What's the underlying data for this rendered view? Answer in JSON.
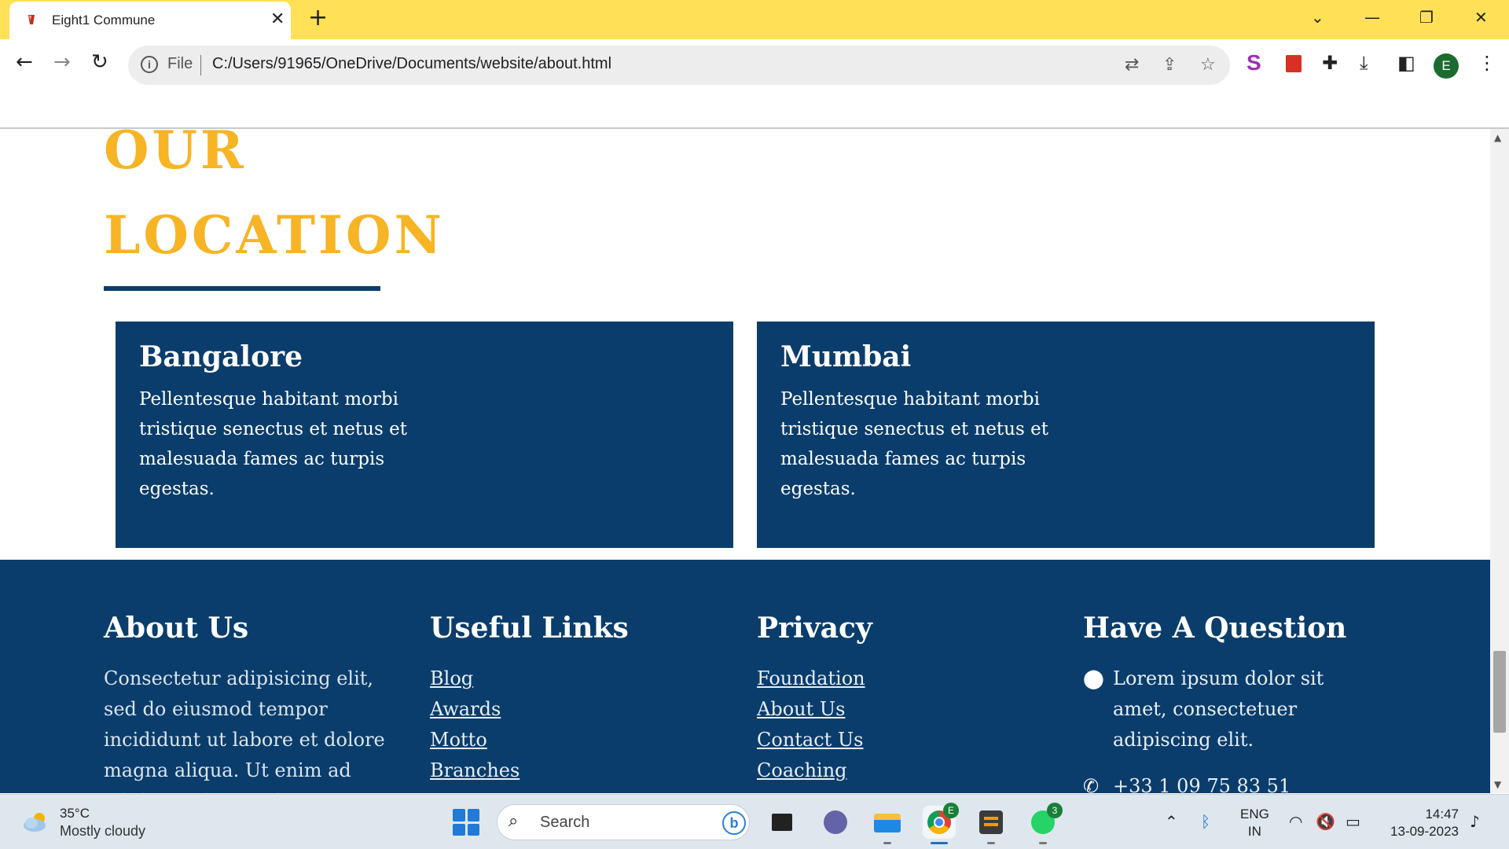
{
  "browser": {
    "tab_title": "Eight1 Commune",
    "close_glyph": "✕",
    "new_tab_glyph": "+",
    "url_scheme_label": "File",
    "url": "C:/Users/91965/OneDrive/Documents/website/about.html",
    "accent_color": "#ffe057",
    "profile_initial": "E"
  },
  "page": {
    "heading_line1": "OUR",
    "heading_line2": "LOCATION",
    "heading_color": "#f7b425",
    "brand_navy": "#0a3d6b",
    "locations": [
      {
        "city": "Bangalore",
        "description": "Pellentesque habitant morbi tristique senectus et netus et malesuada fames ac turpis egestas."
      },
      {
        "city": "Mumbai",
        "description": "Pellentesque habitant morbi tristique senectus et netus et malesuada fames ac turpis egestas."
      }
    ]
  },
  "footer": {
    "about": {
      "title": "About Us",
      "text": "Consectetur adipisicing elit, sed do eiusmod tempor incididunt ut labore et dolore magna aliqua. Ut enim ad minim veniam, quis"
    },
    "useful_links": {
      "title": "Useful Links",
      "links": [
        "Blog",
        "Awards",
        "Motto",
        "Branches"
      ]
    },
    "privacy": {
      "title": "Privacy",
      "links": [
        "Foundation",
        "About Us",
        "Contact Us",
        "Coaching"
      ]
    },
    "question": {
      "title": "Have A Question",
      "address": "Lorem ipsum dolor sit amet, consectetuer adipiscing elit.",
      "phone": "+33 1 09 75 83 51"
    }
  },
  "taskbar": {
    "weather_temp": "35°C",
    "weather_desc": "Mostly cloudy",
    "search_label": "Search",
    "chrome_badge": "E",
    "whatsapp_badge": "3",
    "lang_line1": "ENG",
    "lang_line2": "IN",
    "time": "14:47",
    "date": "13-09-2023"
  },
  "icons": [
    "info-icon",
    "translate-icon",
    "share-icon",
    "star-icon",
    "puzzle-icon",
    "download-icon",
    "side-panel-icon",
    "kebab-menu-icon",
    "location-pin-icon",
    "phone-icon",
    "search-icon",
    "wifi-icon",
    "volume-muted-icon",
    "battery-icon",
    "bluetooth-icon"
  ]
}
